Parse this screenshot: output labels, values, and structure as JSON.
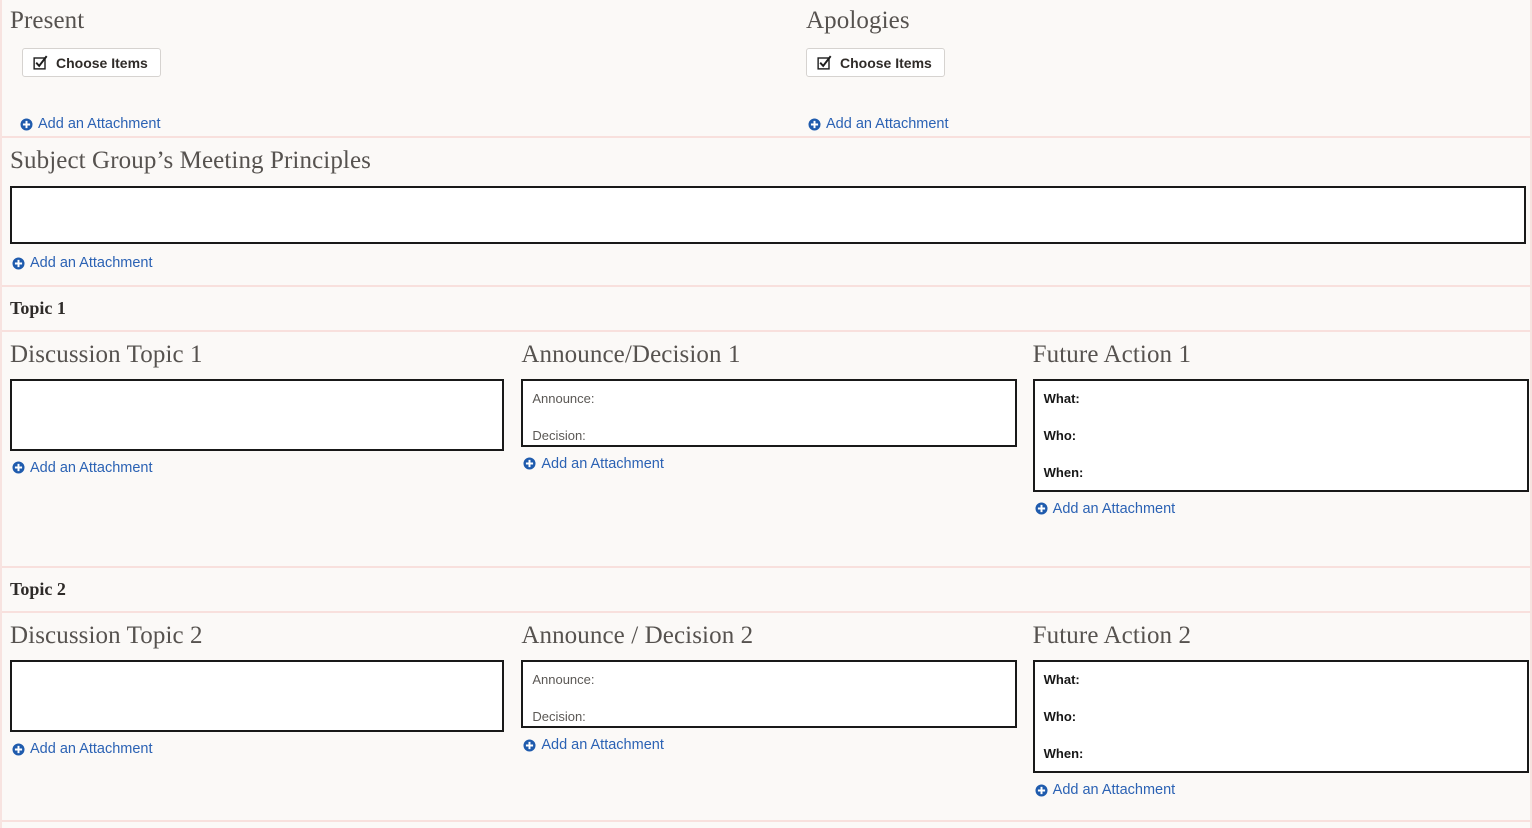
{
  "colors": {
    "page_bg": "#fbf9f7",
    "separator": "#f8e0dd",
    "heading": "#56524f",
    "link": "#2b62b4",
    "box_border": "#191919"
  },
  "icons": {
    "checkbox_checked": "checkbox-checked-icon",
    "plus_circle": "plus-circle-icon"
  },
  "labels": {
    "choose_items": "Choose Items",
    "add_attachment": "Add an Attachment"
  },
  "top": {
    "present": {
      "heading": "Present",
      "button_label": "Choose Items",
      "attachment_label": "Add an Attachment"
    },
    "apologies": {
      "heading": "Apologies",
      "button_label": "Choose Items",
      "attachment_label": "Add an Attachment"
    }
  },
  "principles": {
    "heading": "Subject Group’s Meeting Principles",
    "value": "",
    "attachment_label": "Add an Attachment"
  },
  "topics": [
    {
      "bar_label": "Topic 1",
      "discussion": {
        "heading": "Discussion Topic 1",
        "value": "",
        "attachment_label": "Add an Attachment"
      },
      "announce": {
        "heading": "Announce/Decision 1",
        "lines": [
          "Announce:",
          "Decision:"
        ],
        "attachment_label": "Add an Attachment"
      },
      "future_action": {
        "heading": "Future Action 1",
        "lines": [
          "What:",
          "Who:",
          "When:"
        ],
        "attachment_label": "Add an Attachment"
      }
    },
    {
      "bar_label": "Topic 2",
      "discussion": {
        "heading": "Discussion Topic 2",
        "value": "",
        "attachment_label": "Add an Attachment"
      },
      "announce": {
        "heading": "Announce / Decision 2",
        "lines": [
          "Announce:",
          "Decision:"
        ],
        "attachment_label": "Add an Attachment"
      },
      "future_action": {
        "heading": "Future Action 2",
        "lines": [
          "What:",
          "Who:",
          "When:"
        ],
        "attachment_label": "Add an Attachment"
      }
    }
  ]
}
